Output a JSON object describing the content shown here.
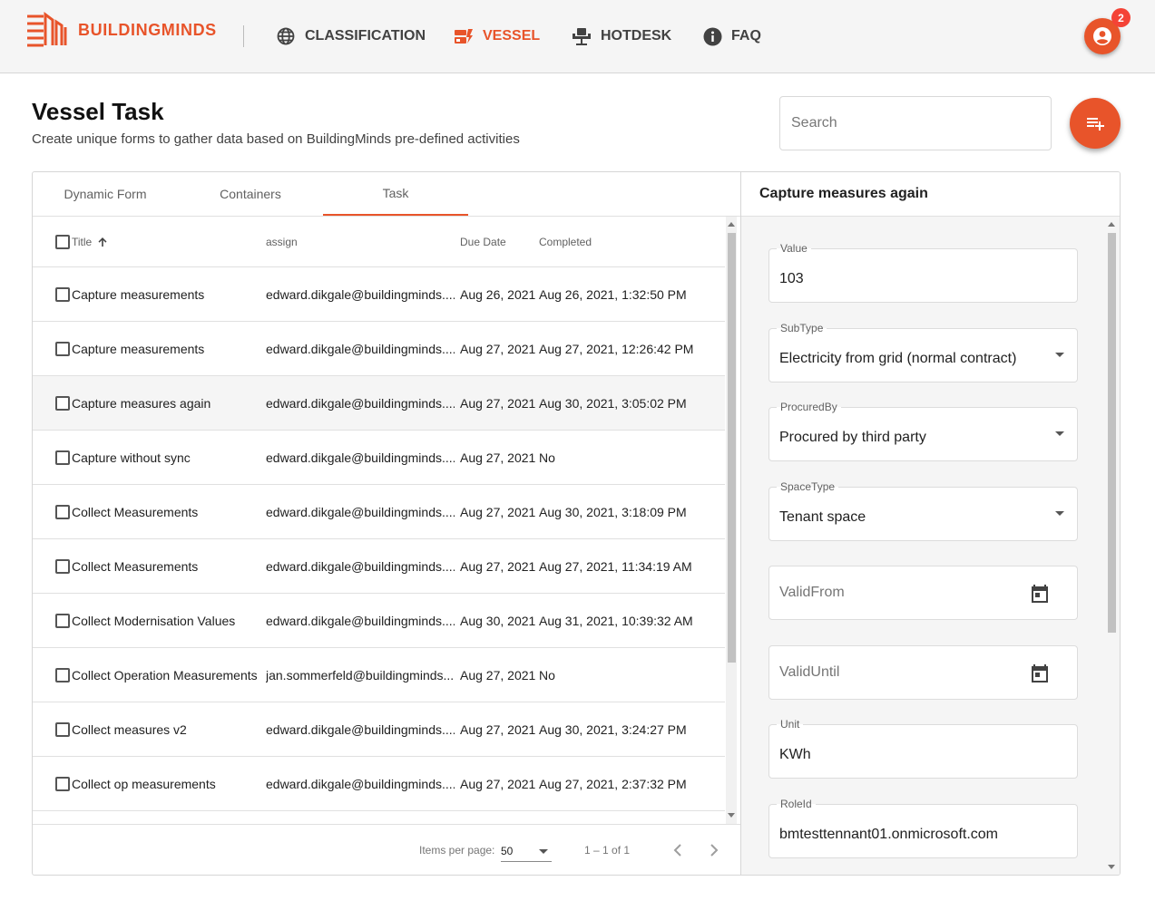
{
  "header": {
    "brand": "BUILDINGMINDS",
    "nav": [
      {
        "label": "CLASSIFICATION",
        "icon": "globe-icon"
      },
      {
        "label": "VESSEL",
        "icon": "vessel-icon",
        "active": true
      },
      {
        "label": "HOTDESK",
        "icon": "desk-chair-icon"
      },
      {
        "label": "FAQ",
        "icon": "info-icon"
      }
    ],
    "notification_count": "2"
  },
  "page": {
    "title": "Vessel Task",
    "subtitle": "Create unique forms to gather data based on BuildingMinds pre-defined activities",
    "search_placeholder": "Search"
  },
  "tabs": [
    {
      "label": "Dynamic Form"
    },
    {
      "label": "Containers"
    },
    {
      "label": "Task",
      "active": true
    }
  ],
  "table": {
    "columns": {
      "title": "Title",
      "assign": "assign",
      "due": "Due Date",
      "completed": "Completed"
    },
    "rows": [
      {
        "title": "Capture measurements",
        "assign": "edward.dikgale@buildingminds....",
        "due": "Aug 26, 2021",
        "completed": "Aug 26, 2021, 1:32:50 PM"
      },
      {
        "title": "Capture measurements",
        "assign": "edward.dikgale@buildingminds....",
        "due": "Aug 27, 2021",
        "completed": "Aug 27, 2021, 12:26:42 PM"
      },
      {
        "title": "Capture measures again",
        "assign": "edward.dikgale@buildingminds....",
        "due": "Aug 27, 2021",
        "completed": "Aug 30, 2021, 3:05:02 PM"
      },
      {
        "title": "Capture without sync",
        "assign": "edward.dikgale@buildingminds....",
        "due": "Aug 27, 2021",
        "completed": "No"
      },
      {
        "title": "Collect Measurements",
        "assign": "edward.dikgale@buildingminds....",
        "due": "Aug 27, 2021",
        "completed": "Aug 30, 2021, 3:18:09 PM"
      },
      {
        "title": "Collect Measurements",
        "assign": "edward.dikgale@buildingminds....",
        "due": "Aug 27, 2021",
        "completed": "Aug 27, 2021, 11:34:19 AM"
      },
      {
        "title": "Collect Modernisation Values",
        "assign": "edward.dikgale@buildingminds....",
        "due": "Aug 30, 2021",
        "completed": "Aug 31, 2021, 10:39:32 AM"
      },
      {
        "title": "Collect Operation Measurements",
        "assign": "jan.sommerfeld@buildingminds....",
        "due": "Aug 27, 2021",
        "completed": "No"
      },
      {
        "title": "Collect measures v2",
        "assign": "edward.dikgale@buildingminds....",
        "due": "Aug 27, 2021",
        "completed": "Aug 30, 2021, 3:24:27 PM"
      },
      {
        "title": "Collect op measurements",
        "assign": "edward.dikgale@buildingminds....",
        "due": "Aug 27, 2021",
        "completed": "Aug 27, 2021, 2:37:32 PM"
      }
    ]
  },
  "paginator": {
    "items_per_page_label": "Items per page:",
    "items_per_page": "50",
    "range": "1 – 1 of 1"
  },
  "detail": {
    "title": "Capture measures again",
    "fields": [
      {
        "label": "Value",
        "value": "103",
        "kind": "text"
      },
      {
        "label": "SubType",
        "value": "Electricity from grid (normal contract)",
        "kind": "select"
      },
      {
        "label": "ProcuredBy",
        "value": "Procured by third party",
        "kind": "select"
      },
      {
        "label": "SpaceType",
        "value": "Tenant space",
        "kind": "select"
      },
      {
        "label": "ValidFrom",
        "value": "",
        "placeholder": "ValidFrom",
        "kind": "date"
      },
      {
        "label": "ValidUntil",
        "value": "",
        "placeholder": "ValidUntil",
        "kind": "date"
      },
      {
        "label": "Unit",
        "value": "KWh",
        "kind": "text"
      },
      {
        "label": "RoleId",
        "value": "bmtesttennant01.onmicrosoft.com",
        "kind": "text"
      }
    ]
  },
  "colors": {
    "accent": "#e8542a",
    "badge": "#f44336"
  }
}
